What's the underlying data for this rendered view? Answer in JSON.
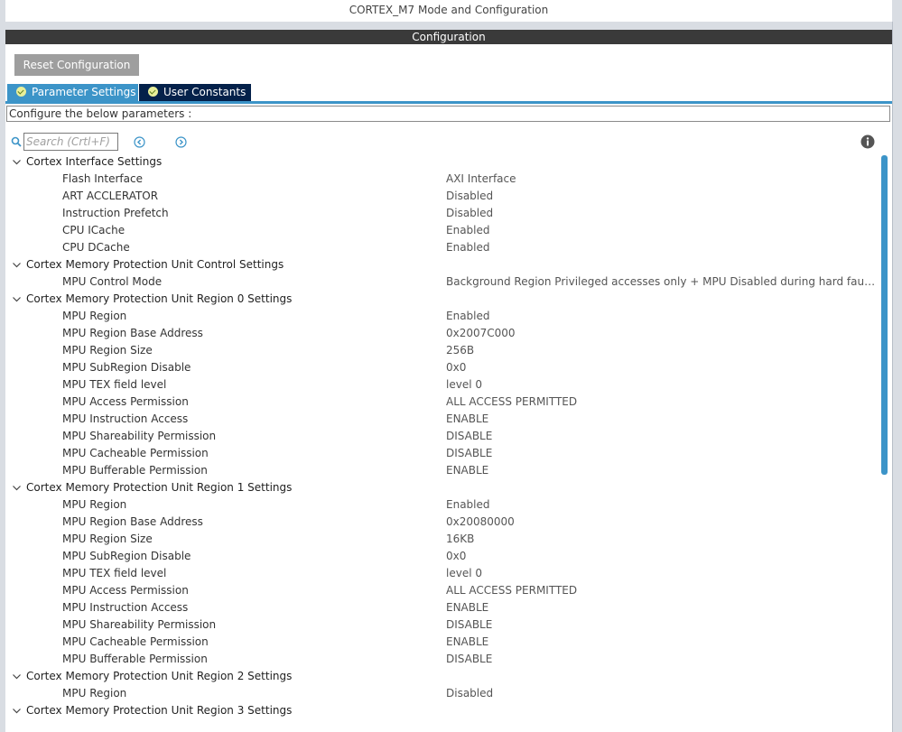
{
  "window": {
    "mode_title": "CORTEX_M7 Mode and Configuration"
  },
  "config_bar": {
    "title": "Configuration"
  },
  "toolbar": {
    "reset_label": "Reset Configuration"
  },
  "tabs": [
    {
      "label": "Parameter Settings",
      "active": true
    },
    {
      "label": "User Constants",
      "active": false
    }
  ],
  "description": "Configure the below parameters :",
  "search": {
    "placeholder": "Search (Crtl+F)"
  },
  "groups": [
    {
      "title": "Cortex Interface Settings",
      "params": [
        {
          "name": "Flash Interface",
          "value": "AXI Interface"
        },
        {
          "name": "ART ACCLERATOR",
          "value": "Disabled"
        },
        {
          "name": "Instruction Prefetch",
          "value": "Disabled"
        },
        {
          "name": "CPU ICache",
          "value": "Enabled"
        },
        {
          "name": "CPU DCache",
          "value": "Enabled"
        }
      ]
    },
    {
      "title": "Cortex Memory Protection Unit Control Settings",
      "params": [
        {
          "name": "MPU Control Mode",
          "value": "Background Region Privileged accesses only + MPU Disabled during hard fault, NMI ..."
        }
      ]
    },
    {
      "title": "Cortex Memory Protection Unit Region 0 Settings",
      "params": [
        {
          "name": "MPU Region",
          "value": "Enabled"
        },
        {
          "name": "MPU Region Base Address",
          "value": "0x2007C000"
        },
        {
          "name": "MPU Region Size",
          "value": "256B"
        },
        {
          "name": "MPU SubRegion Disable",
          "value": "0x0"
        },
        {
          "name": "MPU TEX field level",
          "value": "level 0"
        },
        {
          "name": "MPU Access Permission",
          "value": "ALL ACCESS PERMITTED"
        },
        {
          "name": "MPU Instruction Access",
          "value": "ENABLE"
        },
        {
          "name": "MPU Shareability Permission",
          "value": "DISABLE"
        },
        {
          "name": "MPU Cacheable Permission",
          "value": "DISABLE"
        },
        {
          "name": "MPU Bufferable  Permission",
          "value": "ENABLE"
        }
      ]
    },
    {
      "title": "Cortex Memory Protection Unit Region 1 Settings",
      "params": [
        {
          "name": "MPU Region",
          "value": "Enabled"
        },
        {
          "name": "MPU Region Base Address",
          "value": "0x20080000"
        },
        {
          "name": "MPU Region Size",
          "value": "16KB"
        },
        {
          "name": "MPU SubRegion Disable",
          "value": "0x0"
        },
        {
          "name": "MPU TEX field level",
          "value": "level 0"
        },
        {
          "name": "MPU Access Permission",
          "value": "ALL ACCESS PERMITTED"
        },
        {
          "name": "MPU Instruction Access",
          "value": "ENABLE"
        },
        {
          "name": "MPU Shareability Permission",
          "value": "DISABLE"
        },
        {
          "name": "MPU Cacheable Permission",
          "value": "ENABLE"
        },
        {
          "name": "MPU Bufferable  Permission",
          "value": "DISABLE"
        }
      ]
    },
    {
      "title": "Cortex Memory Protection Unit Region 2 Settings",
      "params": [
        {
          "name": "MPU Region",
          "value": "Disabled"
        }
      ]
    },
    {
      "title": "Cortex Memory Protection Unit Region 3 Settings",
      "params": []
    }
  ],
  "icons": {
    "search": "search-icon",
    "prev": "chevron-left-circle-icon",
    "next": "chevron-right-circle-icon",
    "info": "info-icon",
    "expand": "chevron-down-icon",
    "tab_status": "check-circle-icon"
  },
  "colors": {
    "accent": "#3c94c8",
    "tab_inactive": "#04214a",
    "header_bar": "#3a3a3a",
    "reset_button": "#9e9e9e"
  }
}
